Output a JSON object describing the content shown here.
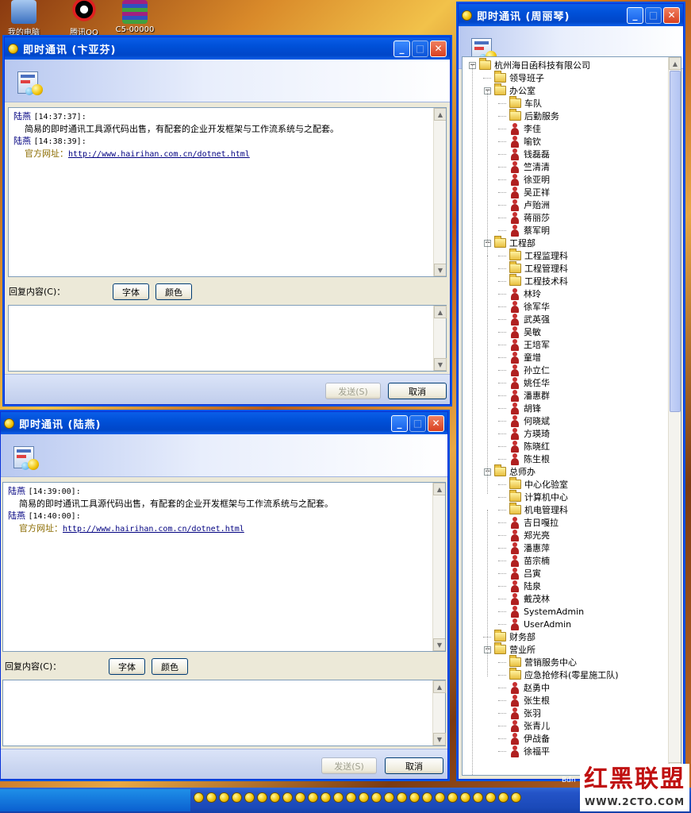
{
  "desktop": {
    "icons": [
      {
        "label": "我的电脑",
        "icon": "computer-icon"
      },
      {
        "label": "腾讯QQ",
        "icon": "qq-penguin-icon"
      },
      {
        "label": "C5-00000",
        "icon": "winrar-icon"
      }
    ]
  },
  "win1": {
    "title": "即时通讯 (卞亚芬)",
    "messages": [
      {
        "sender": "陆燕",
        "time": "[14:37:37]:",
        "text": "简易的即时通讯工具源代码出售，有配套的企业开发框架与工作流系统与之配套。"
      },
      {
        "sender": "陆燕",
        "time": "[14:38:39]:",
        "label": "官方网址：",
        "url": "http://www.hairihan.com.cn/dotnet.html"
      }
    ],
    "reply_label": "回复内容(C)：",
    "font_button": "字体",
    "color_button": "颜色",
    "send_button": "发送(S)",
    "cancel_button": "取消"
  },
  "win2": {
    "title": "即时通讯 (陆燕)",
    "messages": [
      {
        "sender": "陆燕",
        "time": "[14:39:00]:",
        "text": "简易的即时通讯工具源代码出售，有配套的企业开发框架与工作流系统与之配套。"
      },
      {
        "sender": "陆燕",
        "time": "[14:40:00]:",
        "label": "官方网址：",
        "url": "http://www.hairihan.com.cn/dotnet.html"
      }
    ],
    "reply_label": "回复内容(C)：",
    "font_button": "字体",
    "color_button": "颜色",
    "send_button": "发送(S)",
    "cancel_button": "取消"
  },
  "win3": {
    "title": "即时通讯 (周丽琴)",
    "tree": {
      "root": "杭州海日函科技有限公司",
      "l1": {
        "leadership": "领导班子",
        "office": "办公室",
        "engineering": "工程部",
        "chief_eng": "总师办",
        "finance": "财务部",
        "business": "营业所"
      },
      "office_children": [
        "车队",
        "后勤服务",
        "李佳",
        "喻钦",
        "钱磊磊",
        "竺清清",
        "徐亚明",
        "吴正祥",
        "卢贻洲",
        "蒋丽莎",
        "蔡军明"
      ],
      "engineering_children": [
        "工程监理科",
        "工程管理科",
        "工程技术科",
        "林玲",
        "徐军华",
        "武英强",
        "吴敏",
        "王培军",
        "童增",
        "孙立仁",
        "姚任华",
        "潘惠群",
        "胡锋",
        "何晓斌",
        "方瑛琦",
        "陈晓红",
        "陈生根"
      ],
      "chief_children": [
        "中心化验室",
        "计算机中心",
        "机电管理科",
        "吉日嘎拉",
        "郑光亮",
        "潘惠萍",
        "苗宗楠",
        "吕寅",
        "陆泉",
        "戴茂林",
        "SystemAdmin",
        "UserAdmin"
      ],
      "business_children": [
        "营销服务中心",
        "应急抢修科(零星施工队)",
        "赵勇中",
        "张生根",
        "张羽",
        "张青儿",
        "伊战备",
        "徐福平"
      ]
    }
  },
  "taskbar": {
    "tray_text": "Bdn"
  },
  "watermark": {
    "title": "红黑联盟",
    "url": "WWW.2CTO.COM"
  }
}
